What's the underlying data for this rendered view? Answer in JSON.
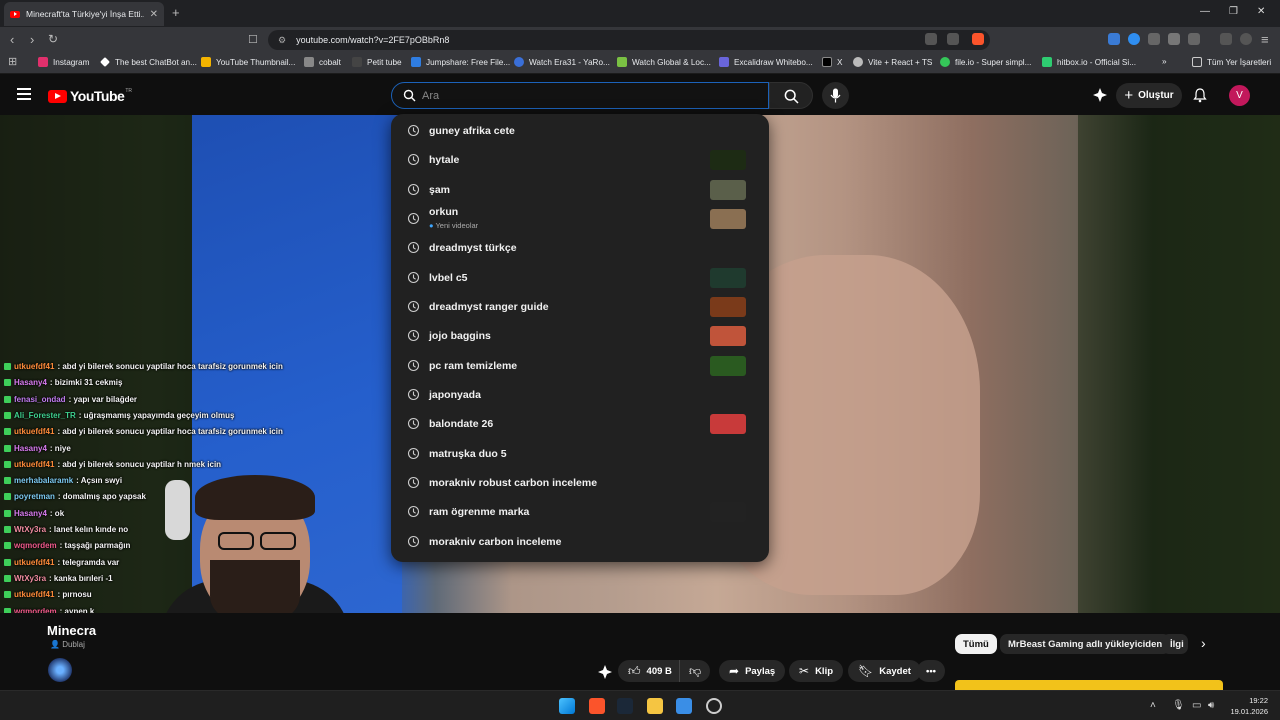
{
  "browser": {
    "tab_title": "Minecraft'ta Türkiye'yi İnşa Etti...",
    "url": "youtube.com/watch?v=2FE7pOBbRn8",
    "bookmarks": [
      {
        "label": "Instagram",
        "color": "#e1306c"
      },
      {
        "label": "The best ChatBot an...",
        "color": "#ffffff"
      },
      {
        "label": "YouTube Thumbnail...",
        "color": "#f4b400"
      },
      {
        "label": "cobalt",
        "color": "#888888"
      },
      {
        "label": "Petit tube",
        "color": "#333333"
      },
      {
        "label": "Jumpshare: Free File...",
        "color": "#2f7de1"
      },
      {
        "label": "Watch Era31 - YaRo...",
        "color": "#3a6fd8"
      },
      {
        "label": "Watch Global & Loc...",
        "color": "#7ac143"
      },
      {
        "label": "Excalidraw Whitebo...",
        "color": "#6965db"
      },
      {
        "label": "X",
        "color": "#000000"
      },
      {
        "label": "Vite + React + TS",
        "color": "#bbbbbb"
      },
      {
        "label": "file.io - Super simpl...",
        "color": "#35c759"
      },
      {
        "label": "hitbox.io - Official Si...",
        "color": "#2ecc71"
      }
    ],
    "overflow_label": "»",
    "all_bookmarks_label": "Tüm Yer İşaretleri"
  },
  "youtube": {
    "logo_text": "YouTube",
    "logo_sup": "TR",
    "search_placeholder": "Ara",
    "create_label": "Oluştur",
    "avatar_letter": "V",
    "suggestions": [
      {
        "text": "guney afrika cete",
        "sub": "",
        "thumb": ""
      },
      {
        "text": "hytale",
        "sub": "",
        "thumb": "#1d2b14"
      },
      {
        "text": "şam",
        "sub": "",
        "thumb": "#5a5f4a"
      },
      {
        "text": "orkun",
        "sub": "Yeni videolar",
        "thumb": "#8a6f52"
      },
      {
        "text": "dreadmyst türkçe",
        "sub": "",
        "thumb": ""
      },
      {
        "text": "lvbel c5",
        "sub": "",
        "thumb": "#1f3a2e"
      },
      {
        "text": "dreadmyst ranger guide",
        "sub": "",
        "thumb": "#7a3a1a"
      },
      {
        "text": "jojo baggins",
        "sub": "",
        "thumb": "#c0543a"
      },
      {
        "text": "pc ram temizleme",
        "sub": "",
        "thumb": "#2a5a20"
      },
      {
        "text": "japonyada",
        "sub": "",
        "thumb": ""
      },
      {
        "text": "balondate 26",
        "sub": "",
        "thumb": "#c83a3a"
      },
      {
        "text": "matruşka duo 5",
        "sub": "",
        "thumb": ""
      },
      {
        "text": "morakniv robust carbon inceleme",
        "sub": "",
        "thumb": ""
      },
      {
        "text": "ram ögrenme marka",
        "sub": "",
        "thumb": "#222222"
      },
      {
        "text": "morakniv carbon inceleme",
        "sub": "",
        "thumb": ""
      }
    ],
    "video_title": "Minecra",
    "channel_sub": "Dublaj",
    "likes": "409 B",
    "share_label": "Paylaş",
    "clip_label": "Klip",
    "save_label": "Kaydet",
    "pills": [
      "Tümü",
      "MrBeast Gaming adlı yükleyiciden",
      "İlgi"
    ]
  },
  "chat": [
    {
      "user": "utkuefdf41",
      "msg": ": abd yi bilerek sonucu yaptilar hoca tarafsiz gorunmek icin",
      "color": "#ff8c3a"
    },
    {
      "user": "Hasany4",
      "msg": ": bizimki 31 cekmiş",
      "color": "#d97cf0"
    },
    {
      "user": "fenasi_ondad",
      "msg": ": yapı var bilağder",
      "color": "#c07cf0"
    },
    {
      "user": "Ali_Forester_TR",
      "msg": ": uğraşmamış yapayımda geçeyim olmuş",
      "color": "#3ecf8e"
    },
    {
      "user": "utkuefdf41",
      "msg": ": abd yi bilerek sonucu yaptilar hoca tarafsiz gorunmek icin",
      "color": "#ff8c3a"
    },
    {
      "user": "Hasany4",
      "msg": ": niye",
      "color": "#d97cf0"
    },
    {
      "user": "utkuefdf41",
      "msg": ": abd yi bilerek sonucu yaptilar h          nmek icin",
      "color": "#ff8c3a"
    },
    {
      "user": "merhabalaramk",
      "msg": ": Açsın swyi",
      "color": "#7cc9f0"
    },
    {
      "user": "poyretman",
      "msg": ": domalmış apo yapsak",
      "color": "#7cc9f0"
    },
    {
      "user": "Hasany4",
      "msg": ": ok",
      "color": "#d97cf0"
    },
    {
      "user": "WtXy3ra",
      "msg": ": lanet kelın kınde no",
      "color": "#f08ca0"
    },
    {
      "user": "wqmordem",
      "msg": ": taşşağı parmağın",
      "color": "#f05a8c"
    },
    {
      "user": "utkuefdf41",
      "msg": ": telegramda var",
      "color": "#ff8c3a"
    },
    {
      "user": "WtXy3ra",
      "msg": ": kanka bırıleri -1",
      "color": "#f08ca0"
    },
    {
      "user": "utkuefdf41",
      "msg": ": pırnosu",
      "color": "#ff8c3a"
    },
    {
      "user": "wqmordem",
      "msg": ": aynen k",
      "color": "#f05a8c"
    }
  ],
  "taskbar": {
    "time": "19:22",
    "date": "19.01.2026"
  }
}
